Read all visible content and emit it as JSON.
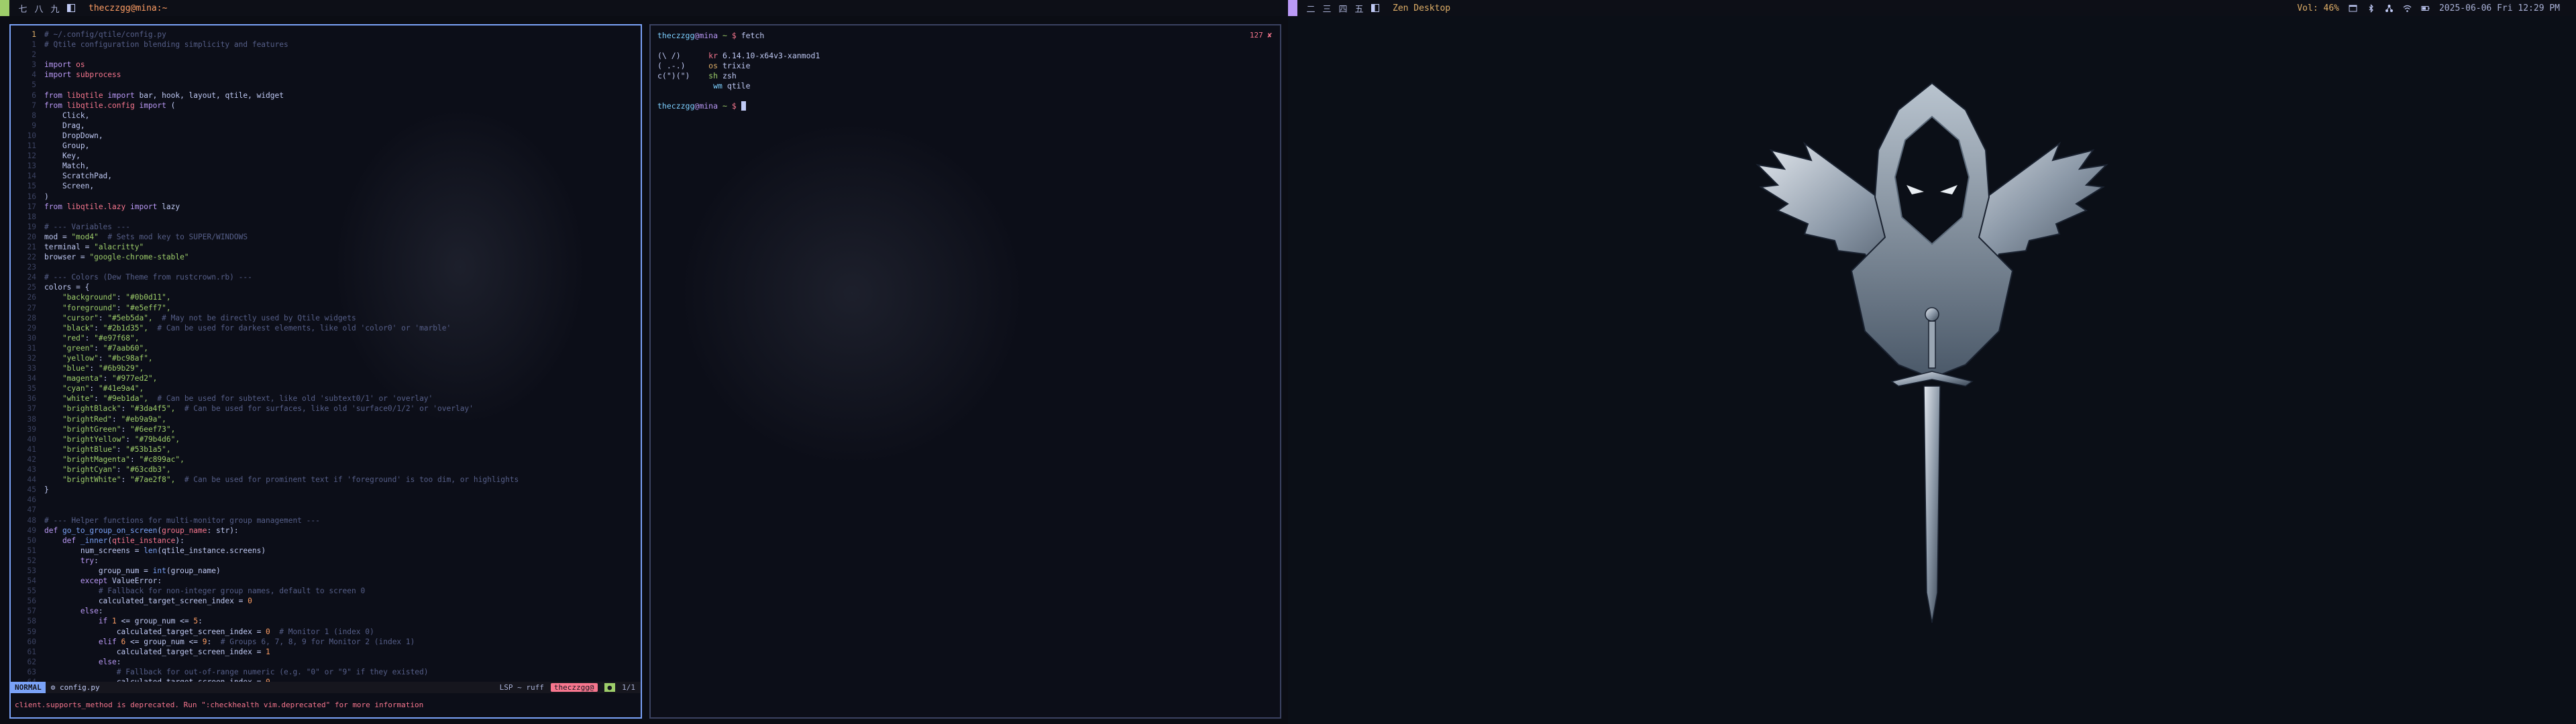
{
  "left_bar": {
    "groups": [
      "七",
      "八",
      "九"
    ],
    "active_color": "#9ece6a",
    "window_title": "theczzgg@mina:~"
  },
  "right_bar": {
    "groups": [
      "二",
      "三",
      "四",
      "五"
    ],
    "active_color": "#bb9af7",
    "window_title": "Zen Desktop",
    "volume": "Vol: 46%",
    "datetime": "2025-06-06 Fri 12:29 PM",
    "tray_icons": [
      "window-icon",
      "bluetooth-icon",
      "network-icon",
      "wifi-icon",
      "battery-icon"
    ]
  },
  "nvim": {
    "lines": [
      {
        "n": "1",
        "cur": true,
        "segs": [
          [
            "cm",
            "# ~/.config/qtile/config.py"
          ]
        ]
      },
      {
        "n": "1",
        "segs": [
          [
            "cm",
            "# Qtile configuration blending simplicity and features"
          ]
        ]
      },
      {
        "n": "2",
        "segs": [
          [
            "txt",
            ""
          ]
        ]
      },
      {
        "n": "3",
        "segs": [
          [
            "kw",
            "import "
          ],
          [
            "mod",
            "os"
          ]
        ]
      },
      {
        "n": "4",
        "segs": [
          [
            "kw",
            "import "
          ],
          [
            "mod",
            "subprocess"
          ]
        ]
      },
      {
        "n": "5",
        "segs": [
          [
            "txt",
            ""
          ]
        ]
      },
      {
        "n": "6",
        "segs": [
          [
            "kw",
            "from "
          ],
          [
            "mod",
            "libqtile"
          ],
          [
            "kw",
            " import "
          ],
          [
            "txt",
            "bar, hook, layout, qtile, widget"
          ]
        ]
      },
      {
        "n": "7",
        "segs": [
          [
            "kw",
            "from "
          ],
          [
            "mod",
            "libqtile.config"
          ],
          [
            "kw",
            " import "
          ],
          [
            "txt",
            "("
          ]
        ]
      },
      {
        "n": "8",
        "segs": [
          [
            "txt",
            "    Click,"
          ]
        ]
      },
      {
        "n": "9",
        "segs": [
          [
            "txt",
            "    Drag,"
          ]
        ]
      },
      {
        "n": "10",
        "segs": [
          [
            "txt",
            "    DropDown,"
          ]
        ]
      },
      {
        "n": "11",
        "segs": [
          [
            "txt",
            "    Group,"
          ]
        ]
      },
      {
        "n": "12",
        "segs": [
          [
            "txt",
            "    Key,"
          ]
        ]
      },
      {
        "n": "13",
        "segs": [
          [
            "txt",
            "    Match,"
          ]
        ]
      },
      {
        "n": "14",
        "segs": [
          [
            "txt",
            "    ScratchPad,"
          ]
        ]
      },
      {
        "n": "15",
        "segs": [
          [
            "txt",
            "    Screen,"
          ]
        ]
      },
      {
        "n": "16",
        "segs": [
          [
            "txt",
            ")"
          ]
        ]
      },
      {
        "n": "17",
        "segs": [
          [
            "kw",
            "from "
          ],
          [
            "mod",
            "libqtile.lazy"
          ],
          [
            "kw",
            " import "
          ],
          [
            "txt",
            "lazy"
          ]
        ]
      },
      {
        "n": "18",
        "segs": [
          [
            "txt",
            ""
          ]
        ]
      },
      {
        "n": "19",
        "segs": [
          [
            "cm",
            "# --- Variables ---"
          ]
        ]
      },
      {
        "n": "20",
        "segs": [
          [
            "txt",
            "mod = "
          ],
          [
            "str",
            "\"mod4\""
          ],
          [
            "cm",
            "  # Sets mod key to SUPER/WINDOWS"
          ]
        ]
      },
      {
        "n": "21",
        "segs": [
          [
            "txt",
            "terminal = "
          ],
          [
            "str",
            "\"alacritty\""
          ]
        ]
      },
      {
        "n": "22",
        "segs": [
          [
            "txt",
            "browser = "
          ],
          [
            "str",
            "\"google-chrome-stable\""
          ]
        ]
      },
      {
        "n": "23",
        "segs": [
          [
            "txt",
            ""
          ]
        ]
      },
      {
        "n": "24",
        "segs": [
          [
            "cm",
            "# --- Colors (Dew Theme from rustcrown.rb) ---"
          ]
        ]
      },
      {
        "n": "25",
        "segs": [
          [
            "txt",
            "colors = {"
          ]
        ]
      },
      {
        "n": "26",
        "segs": [
          [
            "str",
            "    \"background\""
          ],
          [
            "txt",
            ": "
          ],
          [
            "str",
            "\"#0b0d11\","
          ]
        ]
      },
      {
        "n": "27",
        "segs": [
          [
            "str",
            "    \"foreground\""
          ],
          [
            "txt",
            ": "
          ],
          [
            "str",
            "\"#e5eff7\","
          ]
        ]
      },
      {
        "n": "28",
        "segs": [
          [
            "str",
            "    \"cursor\""
          ],
          [
            "txt",
            ": "
          ],
          [
            "str",
            "\"#5eb5da\","
          ],
          [
            "cm",
            "  # May not be directly used by Qtile widgets"
          ]
        ]
      },
      {
        "n": "29",
        "segs": [
          [
            "str",
            "    \"black\""
          ],
          [
            "txt",
            ": "
          ],
          [
            "str",
            "\"#2b1d35\","
          ],
          [
            "cm",
            "  # Can be used for darkest elements, like old 'color0' or 'marble'"
          ]
        ]
      },
      {
        "n": "30",
        "segs": [
          [
            "str",
            "    \"red\""
          ],
          [
            "txt",
            ": "
          ],
          [
            "str",
            "\"#e97f68\","
          ]
        ]
      },
      {
        "n": "31",
        "segs": [
          [
            "str",
            "    \"green\""
          ],
          [
            "txt",
            ": "
          ],
          [
            "str",
            "\"#7aab60\","
          ]
        ]
      },
      {
        "n": "32",
        "segs": [
          [
            "str",
            "    \"yellow\""
          ],
          [
            "txt",
            ": "
          ],
          [
            "str",
            "\"#bc98af\","
          ]
        ]
      },
      {
        "n": "33",
        "segs": [
          [
            "str",
            "    \"blue\""
          ],
          [
            "txt",
            ": "
          ],
          [
            "str",
            "\"#6b9b29\","
          ]
        ]
      },
      {
        "n": "34",
        "segs": [
          [
            "str",
            "    \"magenta\""
          ],
          [
            "txt",
            ": "
          ],
          [
            "str",
            "\"#977ed2\","
          ]
        ]
      },
      {
        "n": "35",
        "segs": [
          [
            "str",
            "    \"cyan\""
          ],
          [
            "txt",
            ": "
          ],
          [
            "str",
            "\"#41e9a4\","
          ]
        ]
      },
      {
        "n": "36",
        "segs": [
          [
            "str",
            "    \"white\""
          ],
          [
            "txt",
            ": "
          ],
          [
            "str",
            "\"#9eb1da\","
          ],
          [
            "cm",
            "  # Can be used for subtext, like old 'subtext0/1' or 'overlay'"
          ]
        ]
      },
      {
        "n": "37",
        "segs": [
          [
            "str",
            "    \"brightBlack\""
          ],
          [
            "txt",
            ": "
          ],
          [
            "str",
            "\"#3da4f5\","
          ],
          [
            "cm",
            "  # Can be used for surfaces, like old 'surface0/1/2' or 'overlay'"
          ]
        ]
      },
      {
        "n": "38",
        "segs": [
          [
            "str",
            "    \"brightRed\""
          ],
          [
            "txt",
            ": "
          ],
          [
            "str",
            "\"#eb9a9a\","
          ]
        ]
      },
      {
        "n": "39",
        "segs": [
          [
            "str",
            "    \"brightGreen\""
          ],
          [
            "txt",
            ": "
          ],
          [
            "str",
            "\"#6eef73\","
          ]
        ]
      },
      {
        "n": "40",
        "segs": [
          [
            "str",
            "    \"brightYellow\""
          ],
          [
            "txt",
            ": "
          ],
          [
            "str",
            "\"#79b4d6\","
          ]
        ]
      },
      {
        "n": "41",
        "segs": [
          [
            "str",
            "    \"brightBlue\""
          ],
          [
            "txt",
            ": "
          ],
          [
            "str",
            "\"#53b1a5\","
          ]
        ]
      },
      {
        "n": "42",
        "segs": [
          [
            "str",
            "    \"brightMagenta\""
          ],
          [
            "txt",
            ": "
          ],
          [
            "str",
            "\"#c899ac\","
          ]
        ]
      },
      {
        "n": "43",
        "segs": [
          [
            "str",
            "    \"brightCyan\""
          ],
          [
            "txt",
            ": "
          ],
          [
            "str",
            "\"#63cdb3\","
          ]
        ]
      },
      {
        "n": "44",
        "segs": [
          [
            "str",
            "    \"brightWhite\""
          ],
          [
            "txt",
            ": "
          ],
          [
            "str",
            "\"#7ae2f8\","
          ],
          [
            "cm",
            "  # Can be used for prominent text if 'foreground' is too dim, or highlights"
          ]
        ]
      },
      {
        "n": "45",
        "segs": [
          [
            "txt",
            "}"
          ]
        ]
      },
      {
        "n": "46",
        "segs": [
          [
            "txt",
            ""
          ]
        ]
      },
      {
        "n": "47",
        "segs": [
          [
            "txt",
            ""
          ]
        ]
      },
      {
        "n": "48",
        "segs": [
          [
            "cm",
            "# --- Helper functions for multi-monitor group management ---"
          ]
        ]
      },
      {
        "n": "49",
        "segs": [
          [
            "kw",
            "def "
          ],
          [
            "fn",
            "go_to_group_on_screen"
          ],
          [
            "txt",
            "("
          ],
          [
            "mod",
            "group_name"
          ],
          [
            "txt",
            ": str):"
          ]
        ]
      },
      {
        "n": "50",
        "segs": [
          [
            "kw",
            "    def "
          ],
          [
            "fn",
            "_inner"
          ],
          [
            "txt",
            "("
          ],
          [
            "mod",
            "qtile_instance"
          ],
          [
            "txt",
            "):"
          ]
        ]
      },
      {
        "n": "51",
        "segs": [
          [
            "txt",
            "        num_screens = "
          ],
          [
            "fn",
            "len"
          ],
          [
            "txt",
            "(qtile_instance.screens)"
          ]
        ]
      },
      {
        "n": "52",
        "segs": [
          [
            "kw",
            "        try"
          ],
          [
            "txt",
            ":"
          ]
        ]
      },
      {
        "n": "53",
        "segs": [
          [
            "txt",
            "            group_num = "
          ],
          [
            "fn",
            "int"
          ],
          [
            "txt",
            "(group_name)"
          ]
        ]
      },
      {
        "n": "54",
        "segs": [
          [
            "kw",
            "        except "
          ],
          [
            "txt",
            "ValueError:"
          ]
        ]
      },
      {
        "n": "55",
        "segs": [
          [
            "cm",
            "            # Fallback for non-integer group names, default to screen 0"
          ]
        ]
      },
      {
        "n": "56",
        "segs": [
          [
            "txt",
            "            calculated_target_screen_index = "
          ],
          [
            "num-l",
            "0"
          ]
        ]
      },
      {
        "n": "57",
        "segs": [
          [
            "kw",
            "        else"
          ],
          [
            "txt",
            ":"
          ]
        ]
      },
      {
        "n": "58",
        "segs": [
          [
            "kw",
            "            if "
          ],
          [
            "num-l",
            "1"
          ],
          [
            "txt",
            " <= group_num <= "
          ],
          [
            "num-l",
            "5"
          ],
          [
            "txt",
            ":"
          ]
        ]
      },
      {
        "n": "59",
        "segs": [
          [
            "txt",
            "                calculated_target_screen_index = "
          ],
          [
            "num-l",
            "0"
          ],
          [
            "cm",
            "  # Monitor 1 (index 0)"
          ]
        ]
      },
      {
        "n": "60",
        "segs": [
          [
            "kw",
            "            elif "
          ],
          [
            "num-l",
            "6"
          ],
          [
            "txt",
            " <= group_num <= "
          ],
          [
            "num-l",
            "9"
          ],
          [
            "txt",
            ":"
          ],
          [
            "cm",
            "  # Groups 6, 7, 8, 9 for Monitor 2 (index 1)"
          ]
        ]
      },
      {
        "n": "61",
        "segs": [
          [
            "txt",
            "                calculated_target_screen_index = "
          ],
          [
            "num-l",
            "1"
          ]
        ]
      },
      {
        "n": "62",
        "segs": [
          [
            "kw",
            "            else"
          ],
          [
            "txt",
            ":"
          ]
        ]
      },
      {
        "n": "63",
        "segs": [
          [
            "cm",
            "                # Fallback for out-of-range numeric (e.g. \"0\" or \"9\" if they existed)"
          ]
        ]
      },
      {
        "n": "64",
        "segs": [
          [
            "txt",
            "                calculated_target_screen_index = "
          ],
          [
            "num-l",
            "0"
          ]
        ]
      }
    ],
    "status": {
      "mode": "NORMAL",
      "file": "config.py",
      "lsp": "LSP ~ ruff",
      "user": "theczzgg@",
      "position": "1/1"
    },
    "message": "client.supports_method is deprecated. Run \":checkhealth vim.deprecated\" for more information"
  },
  "terminal": {
    "prompt_user": "theczzgg",
    "prompt_host": "mina",
    "prompt_path": "~",
    "command": "fetch",
    "right_status": "127",
    "fetch": {
      "art": [
        "(\\ /)",
        "( .-.)",
        "c(\")(\")"
      ],
      "labels": [
        "kr",
        "os",
        "sh",
        "wm"
      ],
      "values": [
        "6.14.10-x64v3-xanmod1",
        "trixie",
        "zsh",
        "qtile"
      ]
    }
  },
  "desktop": {
    "wallpaper": "hooded-winged-figure-with-sword"
  }
}
